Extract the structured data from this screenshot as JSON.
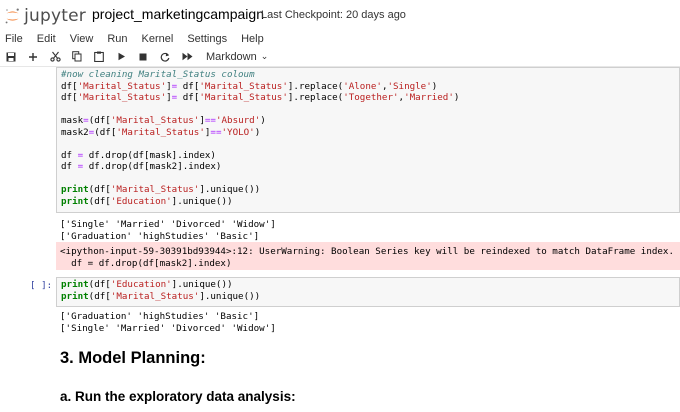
{
  "header": {
    "logo_text": "jupyter",
    "notebook_name": "project_marketingcampaign",
    "checkpoint": "Last Checkpoint: 20 days ago"
  },
  "menu": [
    "File",
    "Edit",
    "View",
    "Run",
    "Kernel",
    "Settings",
    "Help"
  ],
  "toolbar": {
    "cell_type": "Markdown"
  },
  "cell1": {
    "lines": [
      [
        {
          "t": "#now cleaning Marital_Status coloum",
          "c": "cm-comment"
        }
      ],
      [
        {
          "t": "df["
        },
        {
          "t": "'Marital_Status'",
          "c": "cm-str"
        },
        {
          "t": "]"
        },
        {
          "t": "=",
          "c": "cm-op"
        },
        {
          "t": " df["
        },
        {
          "t": "'Marital_Status'",
          "c": "cm-str"
        },
        {
          "t": "].replace("
        },
        {
          "t": "'Alone'",
          "c": "cm-str"
        },
        {
          "t": ","
        },
        {
          "t": "'Single'",
          "c": "cm-str"
        },
        {
          "t": ")"
        }
      ],
      [
        {
          "t": "df["
        },
        {
          "t": "'Marital_Status'",
          "c": "cm-str"
        },
        {
          "t": "]"
        },
        {
          "t": "=",
          "c": "cm-op"
        },
        {
          "t": " df["
        },
        {
          "t": "'Marital_Status'",
          "c": "cm-str"
        },
        {
          "t": "].replace("
        },
        {
          "t": "'Together'",
          "c": "cm-str"
        },
        {
          "t": ","
        },
        {
          "t": "'Married'",
          "c": "cm-str"
        },
        {
          "t": ")"
        }
      ],
      [
        {
          "t": ""
        }
      ],
      [
        {
          "t": "mask"
        },
        {
          "t": "=",
          "c": "cm-op"
        },
        {
          "t": "(df["
        },
        {
          "t": "'Marital_Status'",
          "c": "cm-str"
        },
        {
          "t": "]"
        },
        {
          "t": "==",
          "c": "cm-op"
        },
        {
          "t": "'Absurd'",
          "c": "cm-str"
        },
        {
          "t": ")"
        }
      ],
      [
        {
          "t": "mask2"
        },
        {
          "t": "=",
          "c": "cm-op"
        },
        {
          "t": "(df["
        },
        {
          "t": "'Marital_Status'",
          "c": "cm-str"
        },
        {
          "t": "]"
        },
        {
          "t": "==",
          "c": "cm-op"
        },
        {
          "t": "'YOLO'",
          "c": "cm-str"
        },
        {
          "t": ")"
        }
      ],
      [
        {
          "t": ""
        }
      ],
      [
        {
          "t": "df "
        },
        {
          "t": "=",
          "c": "cm-op"
        },
        {
          "t": " df.drop(df[mask].index)"
        }
      ],
      [
        {
          "t": "df "
        },
        {
          "t": "=",
          "c": "cm-op"
        },
        {
          "t": " df.drop(df[mask2].index)"
        }
      ],
      [
        {
          "t": ""
        }
      ],
      [
        {
          "t": "print",
          "c": "cm-kw"
        },
        {
          "t": "(df["
        },
        {
          "t": "'Marital_Status'",
          "c": "cm-str"
        },
        {
          "t": "].unique())"
        }
      ],
      [
        {
          "t": "print",
          "c": "cm-kw"
        },
        {
          "t": "(df["
        },
        {
          "t": "'Education'",
          "c": "cm-str"
        },
        {
          "t": "].unique())"
        }
      ]
    ],
    "output": [
      "['Single' 'Married' 'Divorced' 'Widow']",
      "['Graduation' 'highStudies' 'Basic']"
    ],
    "stderr": [
      "<ipython-input-59-30391bd93944>:12: UserWarning: Boolean Series key will be reindexed to match DataFrame index.",
      "  df = df.drop(df[mask2].index)"
    ]
  },
  "cell2": {
    "prompt": "[ ]:",
    "lines": [
      [
        {
          "t": "print",
          "c": "cm-kw"
        },
        {
          "t": "(df["
        },
        {
          "t": "'Education'",
          "c": "cm-str"
        },
        {
          "t": "].unique())"
        }
      ],
      [
        {
          "t": "print",
          "c": "cm-kw"
        },
        {
          "t": "(df["
        },
        {
          "t": "'Marital_Status'",
          "c": "cm-str"
        },
        {
          "t": "].unique())"
        }
      ]
    ],
    "output": [
      "['Graduation' 'highStudies' 'Basic']",
      "['Single' 'Married' 'Divorced' 'Widow']"
    ]
  },
  "markdown": {
    "h2": "3. Model Planning:",
    "h3": "a. Run the exploratory data analysis:"
  }
}
